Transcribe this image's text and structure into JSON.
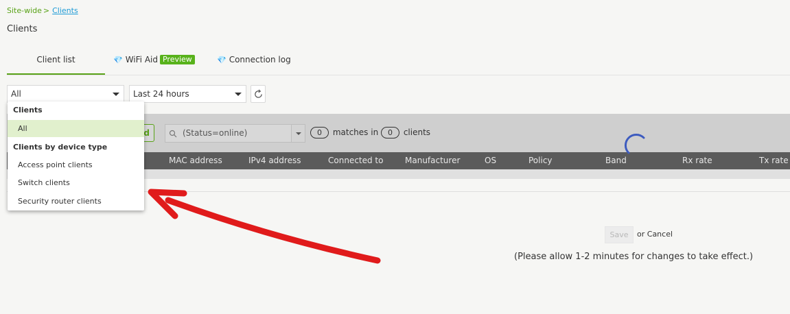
{
  "breadcrumb": {
    "root": "Site-wide",
    "separator": ">",
    "current": "Clients"
  },
  "page": {
    "title": "Clients"
  },
  "tabs": [
    {
      "label": "Client list",
      "active": true
    },
    {
      "label": "WiFi Aid",
      "badge": "Preview",
      "icon": "gem-icon"
    },
    {
      "label": "Connection log",
      "icon": "gem-icon"
    }
  ],
  "filters": {
    "type_value": "All",
    "time_value": "Last 24 hours"
  },
  "toolbar": {
    "button_partial": "d",
    "search_text": "(Status=online)",
    "matches_count": "0",
    "matches_label": "matches in",
    "clients_count": "0",
    "clients_label": "clients"
  },
  "table": {
    "columns": [
      "MAC address",
      "IPv4 address",
      "Connected to",
      "Manufacturer",
      "OS",
      "Policy",
      "Band",
      "Rx rate",
      "Tx rate"
    ]
  },
  "dropdown": {
    "groups": [
      {
        "header": "Clients",
        "items": [
          {
            "label": "All",
            "selected": true
          }
        ]
      },
      {
        "header": "Clients by device type",
        "items": [
          {
            "label": "Access point clients"
          },
          {
            "label": "Switch clients"
          },
          {
            "label": "Security router clients"
          }
        ]
      }
    ]
  },
  "footer": {
    "save_label": "Save",
    "or_label": "or",
    "cancel_label": "Cancel",
    "notice": "(Please allow 1-2 minutes for changes to take effect.)"
  },
  "colors": {
    "accent_green": "#58a216",
    "link_blue": "#1e9bd6",
    "table_header": "#5b5b5b",
    "annotation_red": "#e01b1b",
    "spinner_blue": "#3d5bbf"
  }
}
